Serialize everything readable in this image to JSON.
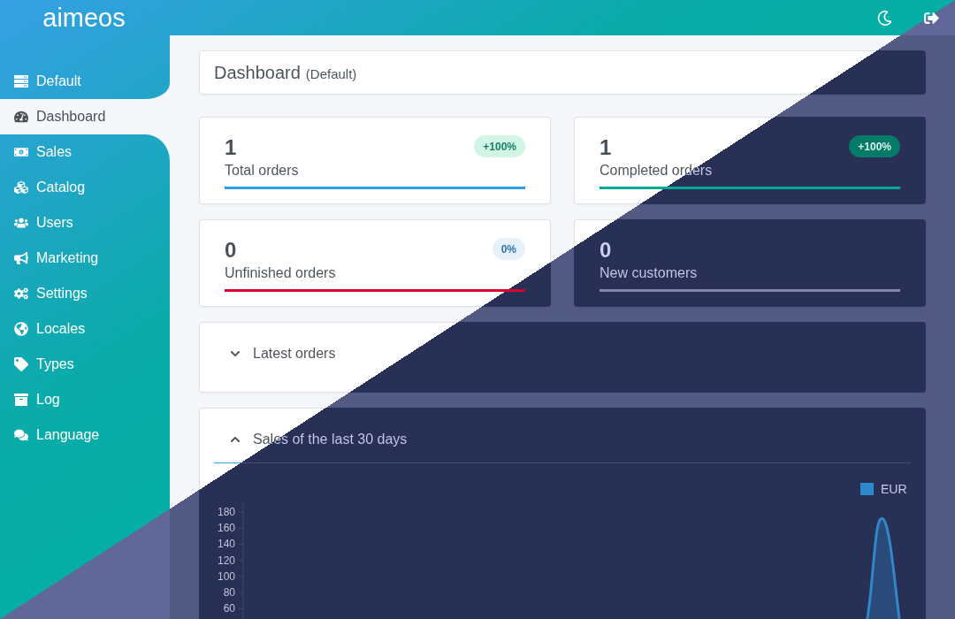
{
  "header": {
    "logo": "aimeos"
  },
  "sidebar": {
    "items": [
      {
        "label": "Default",
        "selected": false
      },
      {
        "label": "Dashboard",
        "selected": true
      },
      {
        "label": "Sales",
        "selected": false
      },
      {
        "label": "Catalog",
        "selected": false
      },
      {
        "label": "Users",
        "selected": false
      },
      {
        "label": "Marketing",
        "selected": false
      },
      {
        "label": "Settings",
        "selected": false
      },
      {
        "label": "Locales",
        "selected": false
      },
      {
        "label": "Types",
        "selected": false
      },
      {
        "label": "Log",
        "selected": false
      },
      {
        "label": "Language",
        "selected": false
      }
    ]
  },
  "page_title": {
    "title": "Dashboard",
    "subtitle": "(Default)"
  },
  "stats": [
    {
      "value": "1",
      "label": "Total orders",
      "badge": {
        "text": "+100%",
        "kind": "positive"
      },
      "color": "#2d9fe3"
    },
    {
      "value": "1",
      "label": "Completed orders",
      "badge": {
        "text": "+100%",
        "kind": "positive"
      },
      "color": "#00a896"
    },
    {
      "value": "0",
      "label": "Unfinished orders",
      "badge": {
        "text": "0%",
        "kind": "neutral"
      },
      "color": "#d9002b"
    },
    {
      "value": "0",
      "label": "New customers",
      "color": "#8186b3"
    }
  ],
  "panels": [
    {
      "title": "Latest orders",
      "expanded": false
    },
    {
      "title": "Sales of the last 30 days",
      "expanded": true,
      "chart": {
        "legend": [
          {
            "label": "EUR",
            "color": "#2f88cb"
          }
        ],
        "y_axis_labels": [
          "180",
          "160",
          "140",
          "120",
          "100",
          "80",
          "60"
        ]
      }
    }
  ]
}
